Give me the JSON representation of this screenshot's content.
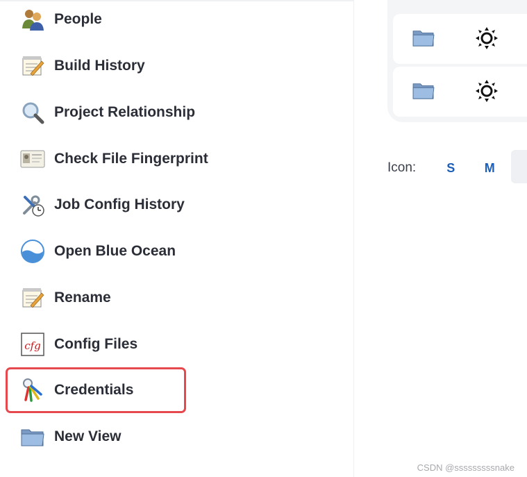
{
  "sidebar": {
    "items": [
      {
        "label": "People",
        "icon": "people-icon"
      },
      {
        "label": "Build History",
        "icon": "notepad-icon"
      },
      {
        "label": "Project Relationship",
        "icon": "magnifier-icon"
      },
      {
        "label": "Check File Fingerprint",
        "icon": "id-card-icon"
      },
      {
        "label": "Job Config History",
        "icon": "tools-clock-icon"
      },
      {
        "label": "Open Blue Ocean",
        "icon": "blue-ocean-icon"
      },
      {
        "label": "Rename",
        "icon": "notepad-icon"
      },
      {
        "label": "Config Files",
        "icon": "cfg-icon"
      },
      {
        "label": "Credentials",
        "icon": "keys-icon"
      },
      {
        "label": "New View",
        "icon": "folder-icon"
      }
    ],
    "highlighted": "Credentials"
  },
  "icon_size": {
    "label": "Icon:",
    "options": [
      "S",
      "M"
    ]
  },
  "watermark": "CSDN @sssssssssnake",
  "colors": {
    "highlight_border": "#e5484d",
    "link": "#1d5fb8",
    "panel_bg": "#f4f5f7"
  }
}
